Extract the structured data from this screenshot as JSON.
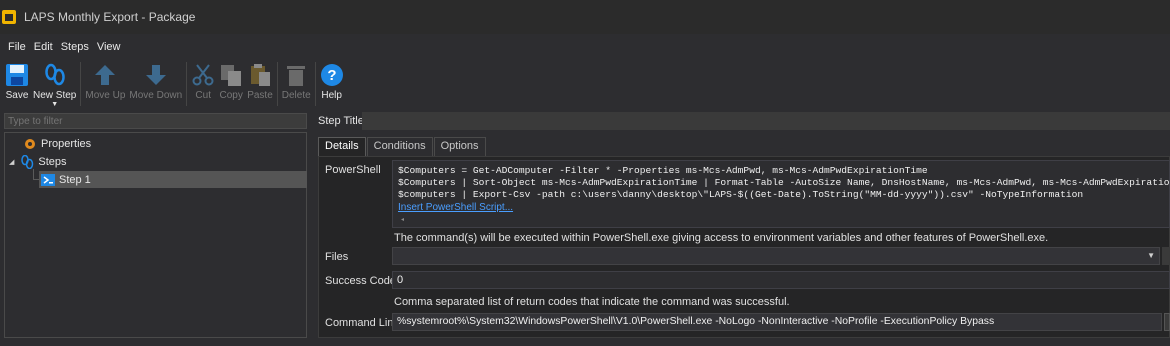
{
  "window": {
    "title": "LAPS Monthly Export - Package"
  },
  "menu": [
    "File",
    "Edit",
    "Steps",
    "View"
  ],
  "toolbar": {
    "save": "Save",
    "new_step": "New Step",
    "move_up": "Move Up",
    "move_down": "Move Down",
    "cut": "Cut",
    "copy": "Copy",
    "paste": "Paste",
    "delete": "Delete",
    "help": "Help"
  },
  "search": {
    "placeholder": "Type to filter"
  },
  "tree": {
    "properties": "Properties",
    "steps": "Steps",
    "step1": "Step 1"
  },
  "step_title": {
    "label": "Step Title",
    "value": ""
  },
  "tabs": [
    "Details",
    "Conditions",
    "Options"
  ],
  "details": {
    "powershell_label": "PowerShell",
    "powershell_lines": [
      "$Computers = Get-ADComputer -Filter * -Properties ms-Mcs-AdmPwd, ms-Mcs-AdmPwdExpirationTime",
      "$Computers | Sort-Object ms-Mcs-AdmPwdExpirationTime | Format-Table -AutoSize Name, DnsHostName, ms-Mcs-AdmPwd, ms-Mcs-AdmPwdExpirationTime",
      "$computers | Export-Csv -path c:\\users\\danny\\desktop\\\"LAPS-$((Get-Date).ToString(\"MM-dd-yyyy\")).csv\" -NoTypeInformation"
    ],
    "insert_script": "Insert PowerShell Script...",
    "powershell_hint": "The command(s) will be executed within PowerShell.exe giving access to environment variables and other features of PowerShell.exe.",
    "files_label": "Files",
    "files_value": "",
    "success_label": "Success Codes",
    "success_value": "0",
    "success_hint": "Comma separated list of return codes that indicate the command was successful.",
    "cmd_label": "Command Line",
    "cmd_value": "%systemroot%\\System32\\WindowsPowerShell\\V1.0\\PowerShell.exe -NoLogo -NonInteractive -NoProfile -ExecutionPolicy Bypass"
  },
  "colors": {
    "background": "#2d2d30",
    "accent_blue": "#1e88e5",
    "link": "#4a9eff",
    "selection": "#555555"
  }
}
